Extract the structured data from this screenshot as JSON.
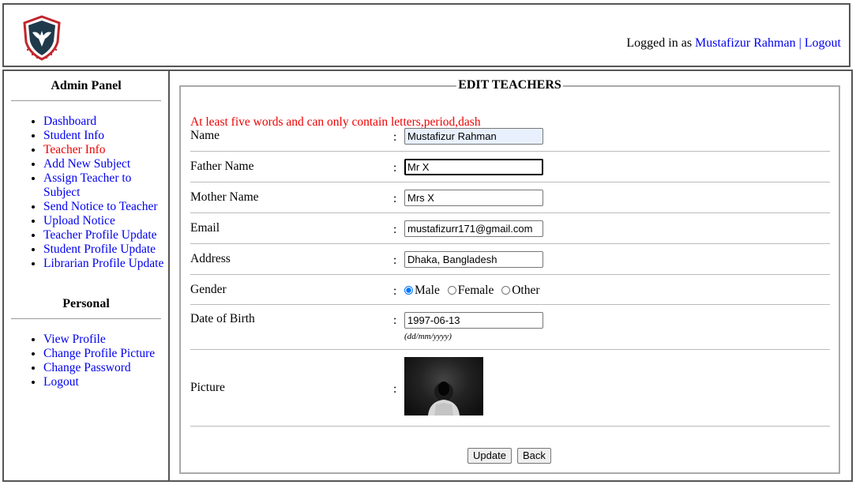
{
  "header": {
    "logged_in_prefix": "Logged in as ",
    "user_name": "Mustafizur Rahman",
    "separator": " | ",
    "logout": "Logout"
  },
  "sidebar": {
    "admin_title": "Admin Panel",
    "admin_items": [
      {
        "label": "Dashboard"
      },
      {
        "label": "Student Info"
      },
      {
        "label": "Teacher Info",
        "active": true
      },
      {
        "label": "Add New Subject"
      },
      {
        "label": "Assign Teacher to Subject"
      },
      {
        "label": "Send Notice to Teacher"
      },
      {
        "label": "Upload Notice"
      },
      {
        "label": "Teacher Profile Update"
      },
      {
        "label": "Student Profile Update"
      },
      {
        "label": "Librarian Profile Update"
      }
    ],
    "personal_title": "Personal",
    "personal_items": [
      {
        "label": "View Profile"
      },
      {
        "label": "Change Profile Picture"
      },
      {
        "label": "Change Password"
      },
      {
        "label": "Logout"
      }
    ]
  },
  "form": {
    "legend": "EDIT TEACHERS",
    "error": "At least five words and can only contain letters,period,dash",
    "colon": ":",
    "name_label": "Name",
    "name_value": "Mustafizur Rahman",
    "father_label": "Father Name",
    "father_value": "Mr X",
    "mother_label": "Mother Name",
    "mother_value": "Mrs X",
    "email_label": "Email",
    "email_value": "mustafizurr171@gmail.com",
    "address_label": "Address",
    "address_value": "Dhaka, Bangladesh",
    "gender_label": "Gender",
    "gender_options": [
      "Male",
      "Female",
      "Other"
    ],
    "gender_selected": "Male",
    "dob_label": "Date of Birth",
    "dob_value": "1997-06-13",
    "dob_hint": "(dd/mm/yyyy)",
    "picture_label": "Picture",
    "update_button": "Update",
    "back_button": "Back"
  },
  "colors": {
    "link": "#0000ee",
    "active_link": "#ee0000",
    "error": "#ee0000",
    "radio_selected": "#0075ff"
  }
}
